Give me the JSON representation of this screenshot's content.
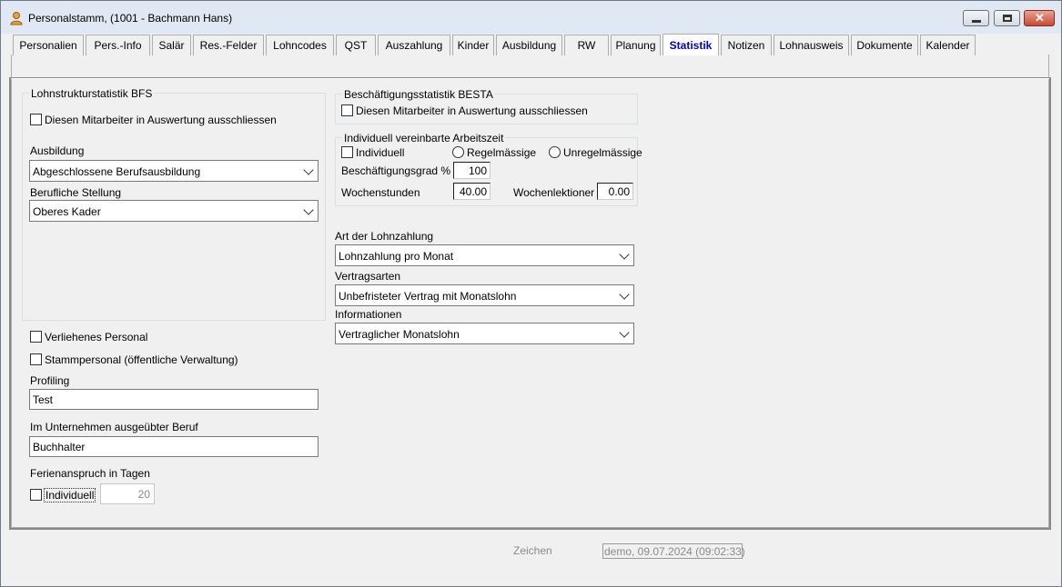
{
  "window": {
    "title": "Personalstamm, (1001 - Bachmann Hans)"
  },
  "tabs": [
    "Personalien",
    "Pers.-Info",
    "Salär",
    "Res.-Felder",
    "Lohncodes",
    "QST",
    "Auszahlung",
    "Kinder",
    "Ausbildung",
    "RW",
    "Planung",
    "Statistik",
    "Notizen",
    "Lohnausweis",
    "Dokumente",
    "Kalender"
  ],
  "active_tab": "Statistik",
  "bfs": {
    "title": "Lohnstrukturstatistik BFS",
    "exclude_label": "Diesen Mitarbeiter in Auswertung ausschliessen",
    "ausbildung_label": "Ausbildung",
    "ausbildung_value": "Abgeschlossene Berufsausbildung",
    "stellung_label": "Berufliche Stellung",
    "stellung_value": "Oberes Kader"
  },
  "left": {
    "verliehen_label": "Verliehenes Personal",
    "stamm_label": "Stammpersonal (öffentliche Verwaltung)",
    "profiling_label": "Profiling",
    "profiling_value": "Test",
    "beruf_label": "Im Unternehmen ausgeübter Beruf",
    "beruf_value": "Buchhalter",
    "ferien_label": "Ferienanspruch in Tagen",
    "individuell_label": "Individuell",
    "ferien_value": "20"
  },
  "besta": {
    "title": "Beschäftigungsstatistik BESTA",
    "exclude_label": "Diesen Mitarbeiter in Auswertung ausschliessen"
  },
  "arbeitszeit": {
    "title": "Individuell vereinbarte Arbeitszeit",
    "individuell_label": "Individuell",
    "regel_label": "Regelmässige",
    "unregel_label": "Unregelmässige",
    "grad_label": "Beschäftigungsgrad %",
    "grad_value": "100",
    "stunden_label": "Wochenstunden",
    "stunden_value": "40.00",
    "lektionen_label": "Wochenlektioner",
    "lektionen_value": "0.00"
  },
  "lohn": {
    "art_label": "Art der Lohnzahlung",
    "art_value": "Lohnzahlung pro Monat",
    "vertrag_label": "Vertragsarten",
    "vertrag_value": "Unbefristeter Vertrag mit Monatslohn",
    "info_label": "Informationen",
    "info_value": "Vertraglicher Monatslohn"
  },
  "footer": {
    "zeichen_label": "Zeichen",
    "zeichen_value": "demo, 09.07.2024 (09:02:33)"
  }
}
